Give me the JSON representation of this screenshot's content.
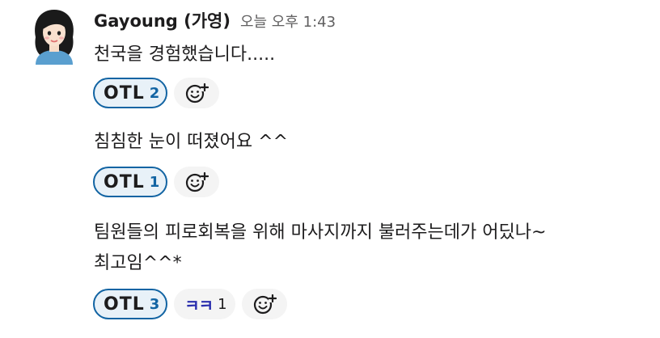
{
  "message": {
    "author": "Gayoung (가영)",
    "timestamp": "오늘 오후 1:43",
    "avatar_icon": "woman-avatar-icon"
  },
  "blocks": [
    {
      "text": "천국을 경험했습니다.....",
      "reactions": [
        {
          "emoji": "OTL",
          "count": "2",
          "mine": true
        }
      ]
    },
    {
      "text": "침침한 눈이 떠졌어요 ^^",
      "reactions": [
        {
          "emoji": "OTL",
          "count": "1",
          "mine": true
        }
      ]
    },
    {
      "text_lines": [
        "팀원들의 피로회복을 위해 마사지까지 불러주는데가 어딨나~",
        "최고임^^*"
      ],
      "reactions": [
        {
          "emoji": "OTL",
          "count": "3",
          "mine": true
        },
        {
          "emoji": "ㅋㅋ",
          "count": "1",
          "mine": false
        }
      ]
    }
  ],
  "add_reaction_icon": "add-reaction-icon",
  "colors": {
    "accent_blue": "#1264a3",
    "reaction_selected_bg": "#e8f1f8",
    "reaction_bg": "#f4f4f4",
    "emoji_blue": "#2b2fae"
  }
}
